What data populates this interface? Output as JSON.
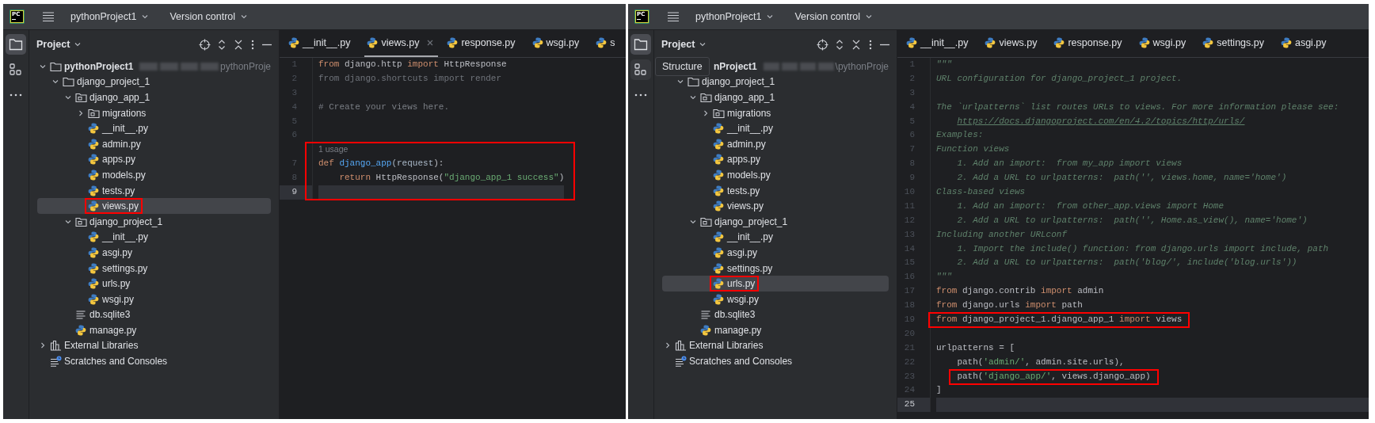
{
  "windows": [
    {
      "title_bar": {
        "logo": "PC",
        "project": "pythonProject1",
        "vcs": "Version control"
      },
      "tool_strip": [
        {
          "kind": "project",
          "selected": true,
          "hovered": false
        },
        {
          "kind": "structure",
          "selected": false,
          "hovered": false
        },
        {
          "kind": "more",
          "selected": false,
          "hovered": false
        }
      ],
      "project_panel": {
        "title": "Project",
        "tree": [
          {
            "label": "pythonProject1",
            "kind": "project",
            "path": "pythonProje",
            "expanded": true,
            "selected": false,
            "children": [
              {
                "label": "django_project_1",
                "kind": "folder",
                "expanded": true,
                "selected": false,
                "children": [
                  {
                    "label": "django_app_1",
                    "kind": "package",
                    "expanded": true,
                    "selected": false,
                    "children": [
                      {
                        "label": "migrations",
                        "kind": "package",
                        "expanded": false,
                        "selected": false
                      },
                      {
                        "label": "__init__.py",
                        "kind": "python",
                        "selected": false
                      },
                      {
                        "label": "admin.py",
                        "kind": "python",
                        "selected": false
                      },
                      {
                        "label": "apps.py",
                        "kind": "python",
                        "selected": false
                      },
                      {
                        "label": "models.py",
                        "kind": "python",
                        "selected": false
                      },
                      {
                        "label": "tests.py",
                        "kind": "python",
                        "selected": false
                      },
                      {
                        "label": "views.py",
                        "kind": "python",
                        "selected": true,
                        "boxed": true
                      }
                    ]
                  },
                  {
                    "label": "django_project_1",
                    "kind": "package",
                    "expanded": true,
                    "selected": false,
                    "children": [
                      {
                        "label": "__init__.py",
                        "kind": "python",
                        "selected": false
                      },
                      {
                        "label": "asgi.py",
                        "kind": "python",
                        "selected": false
                      },
                      {
                        "label": "settings.py",
                        "kind": "python",
                        "selected": false
                      },
                      {
                        "label": "urls.py",
                        "kind": "python",
                        "selected": false
                      },
                      {
                        "label": "wsgi.py",
                        "kind": "python",
                        "selected": false
                      }
                    ]
                  },
                  {
                    "label": "db.sqlite3",
                    "kind": "text",
                    "selected": false
                  },
                  {
                    "label": "manage.py",
                    "kind": "python",
                    "selected": false
                  }
                ]
              }
            ]
          },
          {
            "label": "External Libraries",
            "kind": "library",
            "expanded": false,
            "selected": false
          },
          {
            "label": "Scratches and Consoles",
            "kind": "scratches",
            "selected": false
          }
        ]
      },
      "tabs": [
        {
          "label": "__init__.py",
          "selected": false
        },
        {
          "label": "views.py",
          "selected": true,
          "closable": true
        },
        {
          "label": "response.py",
          "selected": false
        },
        {
          "label": "wsgi.py",
          "selected": false
        },
        {
          "label": "s",
          "selected": false
        }
      ],
      "editor": {
        "lines": [
          {
            "kind": "code",
            "number": "1",
            "current": false,
            "spans": [
              {
                "kind": "keyword",
                "text": "from"
              },
              {
                "kind": "plain",
                "text": " django.http "
              },
              {
                "kind": "keyword",
                "text": "import"
              },
              {
                "kind": "plain",
                "text": " HttpResponse"
              }
            ]
          },
          {
            "kind": "code",
            "number": "2",
            "current": false,
            "spans": [
              {
                "kind": "unused",
                "text": "from django.shortcuts import render"
              }
            ]
          },
          {
            "kind": "code",
            "number": "3",
            "current": false
          },
          {
            "kind": "code",
            "number": "4",
            "current": false,
            "spans": [
              {
                "kind": "comment",
                "text": "# Create your views here."
              }
            ]
          },
          {
            "kind": "code",
            "number": "5",
            "current": false
          },
          {
            "kind": "code",
            "number": "6",
            "current": false
          },
          {
            "kind": "hint",
            "text": "1 usage",
            "boxed": true
          },
          {
            "kind": "code",
            "number": "7",
            "current": false,
            "boxed": true,
            "spans": [
              {
                "kind": "keyword",
                "text": "def "
              },
              {
                "kind": "function",
                "text": "django_app"
              },
              {
                "kind": "param",
                "text": "(request"
              },
              {
                "kind": "plain",
                "text": "):"
              }
            ]
          },
          {
            "kind": "code",
            "number": "8",
            "current": false,
            "boxed": true,
            "spans": [
              {
                "kind": "keyword",
                "text": "    return"
              },
              {
                "kind": "plain",
                "text": " HttpResponse("
              },
              {
                "kind": "string",
                "text": "\"django_app_1 success\""
              },
              {
                "kind": "plain",
                "text": ")"
              }
            ]
          },
          {
            "kind": "code",
            "number": "9",
            "current": true,
            "boxed": true
          }
        ]
      }
    },
    {
      "title_bar": {
        "logo": "PC",
        "project": "pythonProject1",
        "vcs": "Version control"
      },
      "tool_strip": [
        {
          "kind": "project",
          "selected": true,
          "hovered": false
        },
        {
          "kind": "structure",
          "selected": false,
          "hovered": true
        },
        {
          "kind": "more",
          "selected": false,
          "hovered": false
        }
      ],
      "project_panel": {
        "title": "Project",
        "tooltip": "Structure",
        "tree": [
          {
            "label": "nProject1",
            "path": "\\pythonProje",
            "selected": false,
            "children": [
              {
                "label": "django_project_1",
                "kind": "folder",
                "expanded": true,
                "selected": false,
                "children": [
                  {
                    "label": "django_app_1",
                    "kind": "package",
                    "expanded": true,
                    "selected": false,
                    "children": [
                      {
                        "label": "migrations",
                        "kind": "package",
                        "expanded": false,
                        "selected": false
                      },
                      {
                        "label": "__init__.py",
                        "kind": "python",
                        "selected": false
                      },
                      {
                        "label": "admin.py",
                        "kind": "python",
                        "selected": false
                      },
                      {
                        "label": "apps.py",
                        "kind": "python",
                        "selected": false
                      },
                      {
                        "label": "models.py",
                        "kind": "python",
                        "selected": false
                      },
                      {
                        "label": "tests.py",
                        "kind": "python",
                        "selected": false
                      },
                      {
                        "label": "views.py",
                        "kind": "python",
                        "selected": false
                      }
                    ]
                  },
                  {
                    "label": "django_project_1",
                    "kind": "package",
                    "expanded": true,
                    "selected": false,
                    "children": [
                      {
                        "label": "__init__.py",
                        "kind": "python",
                        "selected": false
                      },
                      {
                        "label": "asgi.py",
                        "kind": "python",
                        "selected": false
                      },
                      {
                        "label": "settings.py",
                        "kind": "python",
                        "selected": false
                      },
                      {
                        "label": "urls.py",
                        "kind": "python",
                        "selected": true,
                        "boxed": true
                      },
                      {
                        "label": "wsgi.py",
                        "kind": "python",
                        "selected": false
                      }
                    ]
                  },
                  {
                    "label": "db.sqlite3",
                    "kind": "text",
                    "selected": false
                  },
                  {
                    "label": "manage.py",
                    "kind": "python",
                    "selected": false
                  }
                ]
              }
            ]
          },
          {
            "label": "External Libraries",
            "kind": "library",
            "expanded": false,
            "selected": false
          },
          {
            "label": "Scratches and Consoles",
            "kind": "scratches",
            "selected": false
          }
        ]
      },
      "tabs": [
        {
          "label": "__init__.py",
          "selected": false
        },
        {
          "label": "views.py",
          "selected": false
        },
        {
          "label": "response.py",
          "selected": false
        },
        {
          "label": "wsgi.py",
          "selected": false
        },
        {
          "label": "settings.py",
          "selected": false
        },
        {
          "label": "asgi.py",
          "selected": false
        }
      ],
      "editor": {
        "lines": [
          {
            "kind": "code",
            "number": "1",
            "current": false,
            "spans": [
              {
                "kind": "docstring",
                "text": "\"\"\""
              }
            ]
          },
          {
            "kind": "code",
            "number": "2",
            "current": false,
            "spans": [
              {
                "kind": "docstring",
                "text": "URL configuration for django_project_1 project."
              }
            ]
          },
          {
            "kind": "code",
            "number": "3",
            "current": false
          },
          {
            "kind": "code",
            "number": "4",
            "current": false,
            "spans": [
              {
                "kind": "docstring",
                "text": "The `urlpatterns` list routes URLs to views. For more information please see:"
              }
            ]
          },
          {
            "kind": "code",
            "number": "5",
            "current": false,
            "spans": [
              {
                "kind": "link",
                "text": "    https://docs.djangoproject.com/en/4.2/topics/http/urls/"
              }
            ]
          },
          {
            "kind": "code",
            "number": "6",
            "current": false,
            "spans": [
              {
                "kind": "docstring",
                "text": "Examples:"
              }
            ]
          },
          {
            "kind": "code",
            "number": "7",
            "current": false,
            "spans": [
              {
                "kind": "docstring",
                "text": "Function views"
              }
            ]
          },
          {
            "kind": "code",
            "number": "8",
            "current": false,
            "spans": [
              {
                "kind": "docstring",
                "text": "    1. Add an import:  from my_app import views"
              }
            ]
          },
          {
            "kind": "code",
            "number": "9",
            "current": false,
            "spans": [
              {
                "kind": "docstring",
                "text": "    2. Add a URL to urlpatterns:  path('', views.home, name='home')"
              }
            ]
          },
          {
            "kind": "code",
            "number": "10",
            "current": false,
            "spans": [
              {
                "kind": "docstring",
                "text": "Class-based views"
              }
            ]
          },
          {
            "kind": "code",
            "number": "11",
            "current": false,
            "spans": [
              {
                "kind": "docstring",
                "text": "    1. Add an import:  from other_app.views import Home"
              }
            ]
          },
          {
            "kind": "code",
            "number": "12",
            "current": false,
            "spans": [
              {
                "kind": "docstring",
                "text": "    2. Add a URL to urlpatterns:  path('', Home.as_view(), name='home')"
              }
            ]
          },
          {
            "kind": "code",
            "number": "13",
            "current": false,
            "spans": [
              {
                "kind": "docstring",
                "text": "Including another URLconf"
              }
            ]
          },
          {
            "kind": "code",
            "number": "14",
            "current": false,
            "spans": [
              {
                "kind": "docstring",
                "text": "    1. Import the include() function: from django.urls import include, path"
              }
            ]
          },
          {
            "kind": "code",
            "number": "15",
            "current": false,
            "spans": [
              {
                "kind": "docstring",
                "text": "    2. Add a URL to urlpatterns:  path('blog/', include('blog.urls'))"
              }
            ]
          },
          {
            "kind": "code",
            "number": "16",
            "current": false,
            "spans": [
              {
                "kind": "docstring",
                "text": "\"\"\""
              }
            ]
          },
          {
            "kind": "code",
            "number": "17",
            "current": false,
            "spans": [
              {
                "kind": "keyword",
                "text": "from"
              },
              {
                "kind": "plain",
                "text": " django.contrib "
              },
              {
                "kind": "keyword",
                "text": "import"
              },
              {
                "kind": "plain",
                "text": " admin"
              }
            ]
          },
          {
            "kind": "code",
            "number": "18",
            "current": false,
            "spans": [
              {
                "kind": "keyword",
                "text": "from"
              },
              {
                "kind": "plain",
                "text": " django.urls "
              },
              {
                "kind": "keyword",
                "text": "import"
              },
              {
                "kind": "plain",
                "text": " path"
              }
            ]
          },
          {
            "kind": "code",
            "number": "19",
            "current": false,
            "boxed": true,
            "spans": [
              {
                "kind": "keyword",
                "text": "from"
              },
              {
                "kind": "plain",
                "text": " django_project_1.django_app_1 "
              },
              {
                "kind": "keyword",
                "text": "import"
              },
              {
                "kind": "plain",
                "text": " views"
              }
            ]
          },
          {
            "kind": "code",
            "number": "20",
            "current": false
          },
          {
            "kind": "code",
            "number": "21",
            "current": false,
            "spans": [
              {
                "kind": "plain",
                "text": "urlpatterns = ["
              }
            ]
          },
          {
            "kind": "code",
            "number": "22",
            "current": false,
            "spans": [
              {
                "kind": "plain",
                "text": "    path("
              },
              {
                "kind": "string",
                "text": "'admin/'"
              },
              {
                "kind": "plain",
                "text": ", admin.site.urls),"
              }
            ]
          },
          {
            "kind": "code",
            "number": "23",
            "current": false,
            "boxed": true,
            "spans": [
              {
                "kind": "plain",
                "text": "    path("
              },
              {
                "kind": "string",
                "text": "'django_app/'"
              },
              {
                "kind": "plain",
                "text": ", views.django_app)"
              }
            ]
          },
          {
            "kind": "code",
            "number": "24",
            "current": false,
            "spans": [
              {
                "kind": "plain",
                "text": "]"
              }
            ]
          },
          {
            "kind": "code",
            "number": "25",
            "current": true
          }
        ]
      }
    }
  ]
}
